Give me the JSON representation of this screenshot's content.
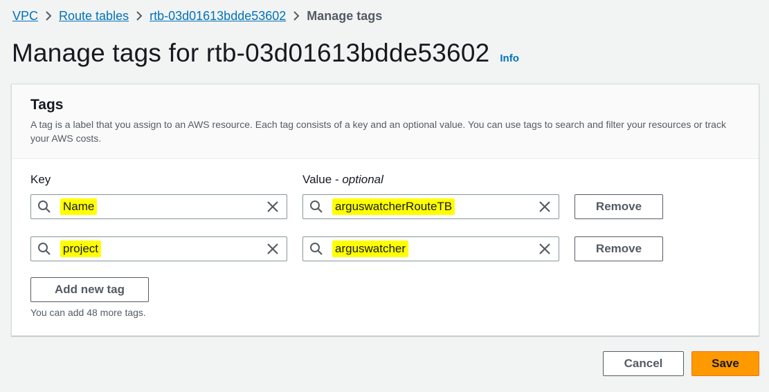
{
  "breadcrumb": {
    "vpc": "VPC",
    "route_tables": "Route tables",
    "route_table_id": "rtb-03d01613bdde53602",
    "current": "Manage tags"
  },
  "page": {
    "title": "Manage tags for rtb-03d01613bdde53602",
    "info_label": "Info"
  },
  "tags_panel": {
    "heading": "Tags",
    "description": "A tag is a label that you assign to an AWS resource. Each tag consists of a key and an optional value. You can use tags to search and filter your resources or track your AWS costs.",
    "key_label": "Key",
    "value_label_prefix": "Value - ",
    "value_label_optional": "optional",
    "rows": [
      {
        "key": "Name",
        "value": "arguswatcherRouteTB",
        "remove_label": "Remove"
      },
      {
        "key": "project",
        "value": "arguswatcher",
        "remove_label": "Remove"
      }
    ],
    "add_label": "Add new tag",
    "hint": "You can add 48 more tags.",
    "highlight_color": "#ffff00"
  },
  "actions": {
    "cancel_label": "Cancel",
    "save_label": "Save"
  },
  "colors": {
    "link": "#0073bb",
    "primary": "#ff9900",
    "background": "#f2f3f3"
  }
}
